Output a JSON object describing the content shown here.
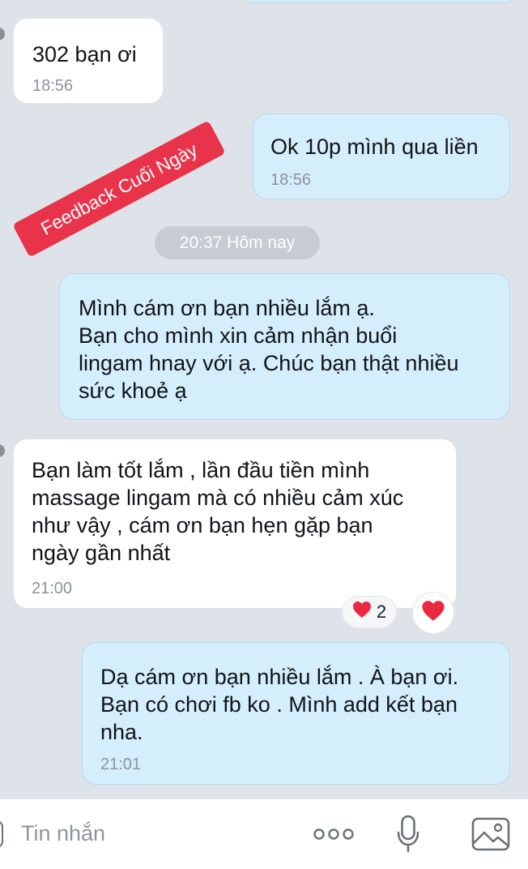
{
  "conversation": {
    "messages": [
      {
        "side": "in",
        "text": "302 bạn ơi",
        "time": "18:56"
      },
      {
        "side": "out",
        "text": "Ok 10p mình qua liền",
        "time": "18:56"
      },
      {
        "side": "out",
        "text": "Mình cám ơn bạn nhiều lắm ạ.\nBạn cho mình xin cảm nhận buổi\nlingam hnay với ạ. Chúc bạn thật nhiều\nsức khoẻ ạ",
        "time": ""
      },
      {
        "side": "in",
        "text": "Bạn làm tốt lắm , lần đầu tiền mình\nmassage lingam mà có nhiều cảm xúc\nnhư vậy , cám ơn bạn hẹn gặp bạn\nngày gần nhất",
        "time": "21:00"
      },
      {
        "side": "out",
        "text": "Dạ cám ơn bạn nhiều lắm . À bạn ơi.\nBạn có chơi fb ko . Mình add kết bạn\nnha.",
        "time": "21:01"
      }
    ],
    "date_separator": "20:37 Hôm nay",
    "reaction": {
      "icon": "heart-icon",
      "count": "2"
    }
  },
  "stamp": {
    "text": "Feedback Cuối Ngày"
  },
  "composer": {
    "placeholder": "Tin nhắn",
    "icons": [
      "more-icon",
      "microphone-icon",
      "image-icon"
    ]
  },
  "colors": {
    "background": "#dde3e9",
    "incoming_bubble": "#ffffff",
    "outgoing_bubble": "#d5eefc",
    "stamp": "#e8334a",
    "heart": "#e8293f"
  }
}
